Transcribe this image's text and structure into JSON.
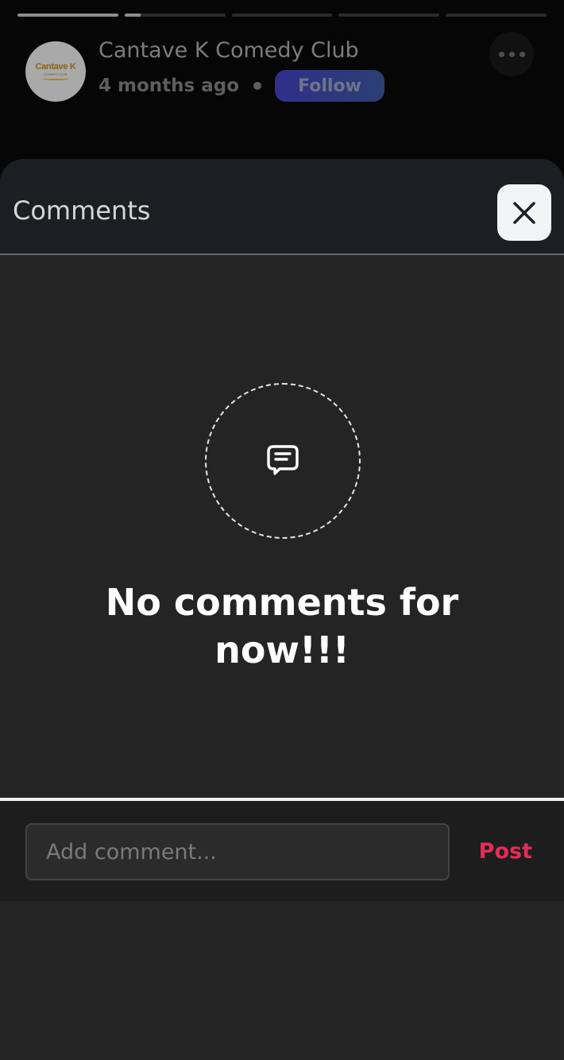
{
  "story": {
    "progress": [
      1,
      0.16,
      0,
      0,
      0
    ],
    "author_name": "Cantave K Comedy Club",
    "avatar_logo": "Cantave K",
    "avatar_logo_sub": "COMEDY CLUB",
    "time_ago": "4 months ago",
    "follow_label": "Follow",
    "more_icon": "ellipsis-icon"
  },
  "comments": {
    "title": "Comments",
    "close_icon": "close-icon",
    "empty_icon": "comment-icon",
    "empty_message": "No comments for now!!!"
  },
  "composer": {
    "placeholder": "Add comment...",
    "value": "",
    "post_label": "Post"
  },
  "colors": {
    "background": "#060606",
    "sheet": "#242424",
    "sheet_header": "#1c1e22",
    "post_accent": "#e02e57",
    "follow_gradient_start": "#2f2f8a",
    "follow_gradient_end": "#2c3f74"
  }
}
